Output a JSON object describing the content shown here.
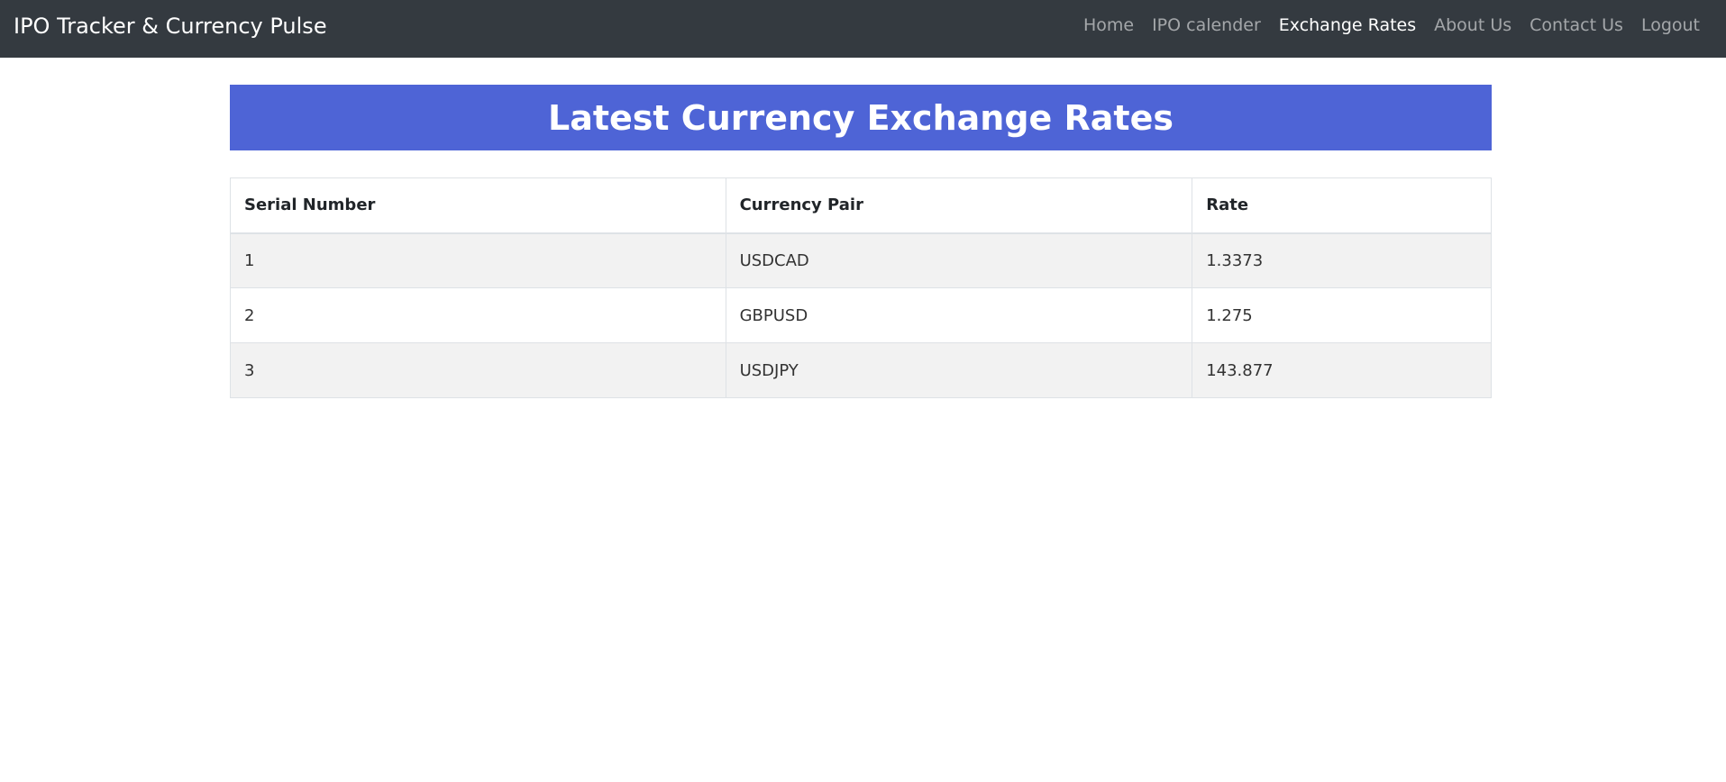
{
  "navbar": {
    "brand": "IPO Tracker & Currency Pulse",
    "links": [
      {
        "label": "Home",
        "active": false
      },
      {
        "label": "IPO calender",
        "active": false
      },
      {
        "label": "Exchange Rates",
        "active": true
      },
      {
        "label": "About Us",
        "active": false
      },
      {
        "label": "Contact Us",
        "active": false
      },
      {
        "label": "Logout",
        "active": false
      }
    ]
  },
  "banner": {
    "title": "Latest Currency Exchange Rates",
    "color": "#4e64d6"
  },
  "table": {
    "headers": [
      "Serial Number",
      "Currency Pair",
      "Rate"
    ],
    "rows": [
      [
        "1",
        "USDCAD",
        "1.3373"
      ],
      [
        "2",
        "GBPUSD",
        "1.275"
      ],
      [
        "3",
        "USDJPY",
        "143.877"
      ]
    ]
  }
}
